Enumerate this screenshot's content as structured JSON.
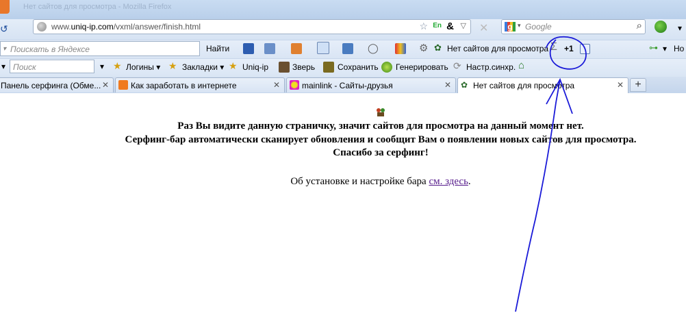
{
  "window": {
    "title_faint": "Нет сайтов для просмотра - Mozilla Firefox"
  },
  "navbar": {
    "url_prefix": "www.",
    "url_domain": "uniq-ip.com",
    "url_path": "/vxml/answer/finish.html",
    "lang_badge": "En",
    "search_placeholder": "Google"
  },
  "toolbar1": {
    "yandex_placeholder": "Поискать в Яндексе",
    "find_label": "Найти",
    "surf_status": "Нет сайтов для просмотра",
    "plus_one": "+1",
    "right_label": "Но"
  },
  "toolbar2": {
    "search_placeholder": "Поиск",
    "items": [
      {
        "label": "Логины ▾"
      },
      {
        "label": "Закладки ▾"
      },
      {
        "label": "Uniq-ip"
      },
      {
        "label": "Зверь"
      },
      {
        "label": "Сохранить"
      },
      {
        "label": "Генерировать"
      },
      {
        "label": "Настр.синхр."
      }
    ]
  },
  "tabs": [
    {
      "label": "Панель серфинга (Обме...",
      "active": false
    },
    {
      "label": "Как заработать в интернете",
      "active": false
    },
    {
      "label": "mainlink - Сайты-друзья",
      "active": false
    },
    {
      "label": "Нет сайтов для просмотра",
      "active": true
    }
  ],
  "page": {
    "line1": "Раз Вы видите данную страничку, значит сайтов для просмотра на данный момент нет.",
    "line2": "Серфинг-бар автоматически сканирует обновления и сообщит Вам о появлении новых сайтов для просмотра.",
    "line3": "Спасибо за серфинг!",
    "setup_text": "Об установке и настройке бара",
    "setup_link": "см. здесь",
    "setup_tail": "."
  },
  "colors": {
    "annotation": "#1a1ad8",
    "link": "#551a8b"
  }
}
